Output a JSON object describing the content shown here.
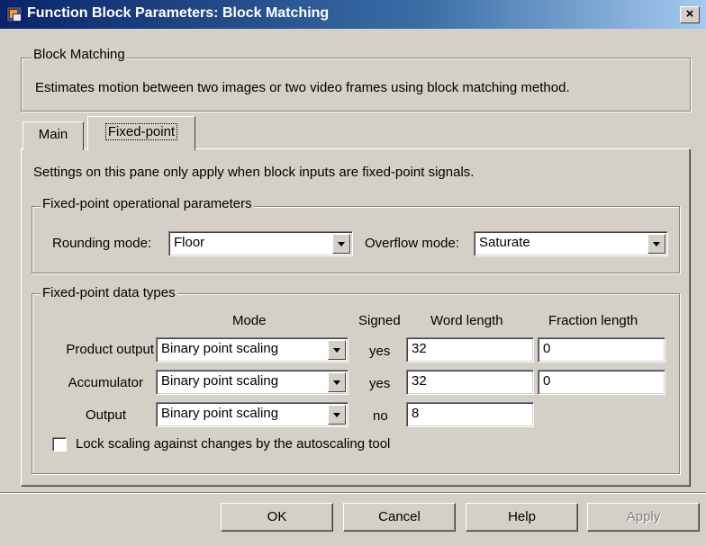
{
  "window": {
    "title": "Function Block Parameters: Block Matching",
    "close_glyph": "×",
    "icon": "simulink-block-icon"
  },
  "description": {
    "group_label": "Block Matching",
    "text": "Estimates motion between two images or two video frames using block matching method."
  },
  "tabs": [
    {
      "label": "Main",
      "active": false
    },
    {
      "label": "Fixed-point",
      "active": true
    }
  ],
  "pane": {
    "info": "Settings on this pane only apply when block inputs are fixed-point signals.",
    "operational": {
      "group_label": "Fixed-point operational parameters",
      "rounding_label": "Rounding mode:",
      "rounding_value": "Floor",
      "overflow_label": "Overflow mode:",
      "overflow_value": "Saturate"
    },
    "datatypes": {
      "group_label": "Fixed-point data types",
      "headers": {
        "mode": "Mode",
        "signed": "Signed",
        "word": "Word length",
        "fraction": "Fraction length"
      },
      "rows": [
        {
          "label": "Product output",
          "mode": "Binary point scaling",
          "signed": "yes",
          "word": "32",
          "fraction": "0"
        },
        {
          "label": "Accumulator",
          "mode": "Binary point scaling",
          "signed": "yes",
          "word": "32",
          "fraction": "0"
        },
        {
          "label": "Output",
          "mode": "Binary point scaling",
          "signed": "no",
          "word": "8"
        }
      ],
      "lock_label": "Lock scaling against changes by the autoscaling tool",
      "lock_checked": false
    }
  },
  "buttons": {
    "ok": "OK",
    "cancel": "Cancel",
    "help": "Help",
    "apply": "Apply"
  }
}
